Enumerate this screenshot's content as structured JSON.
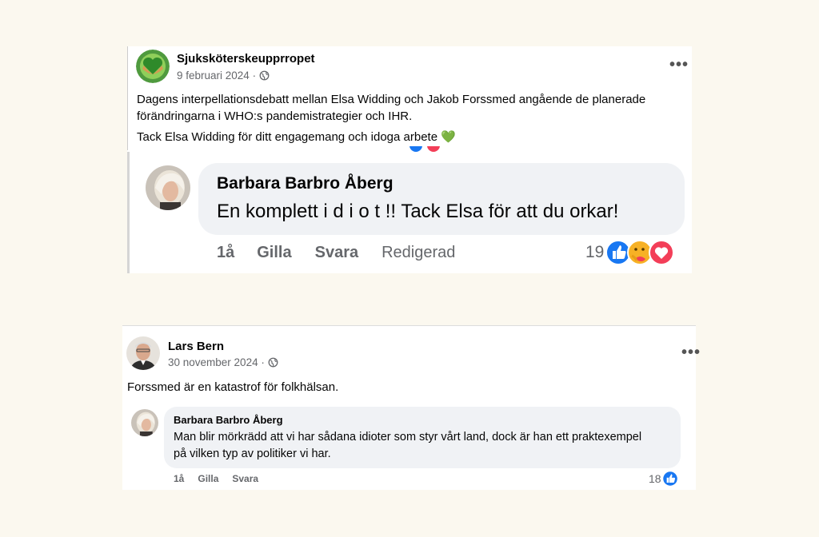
{
  "post1": {
    "author": "Sjuksköterskeupprropet",
    "date": "9 februari 2024 ·",
    "text1": "Dagens interpellationsdebatt mellan Elsa Widding och Jakob Forssmed angående de planerade förändringarna i WHO:s pandemistrategier och IHR.",
    "text2": "Tack Elsa Widding för ditt engagemang och idoga arbete 💚",
    "comment": {
      "author": "Barbara Barbro Åberg",
      "text": "En komplett i d i o t !! Tack Elsa för att du orkar!",
      "time": "1å",
      "like": "Gilla",
      "reply": "Svara",
      "edited": "Redigerad",
      "reaction_count": "19"
    }
  },
  "post2": {
    "author": "Lars Bern",
    "date": "30 november 2024 ·",
    "text": "Forssmed är en katastrof för folkhälsan.",
    "comment": {
      "author": "Barbara Barbro Åberg",
      "text": "Man blir mörkrädd att vi har sådana idioter som styr vårt land, dock är han ett praktexempel på vilken typ av politiker vi har.",
      "time": "1å",
      "like": "Gilla",
      "reply": "Svara",
      "reaction_count": "18"
    }
  },
  "icons": {
    "menu": "more-dots-icon",
    "audience": "globe-icon",
    "like": "like-reaction-icon",
    "care": "care-reaction-icon",
    "love": "love-reaction-icon"
  },
  "colors": {
    "background": "#fbf8ef",
    "like_blue": "#1877f2",
    "love_red": "#f33e58",
    "care_yellow": "#f7b125",
    "meta_gray": "#65676b",
    "bubble": "#f0f2f5"
  }
}
